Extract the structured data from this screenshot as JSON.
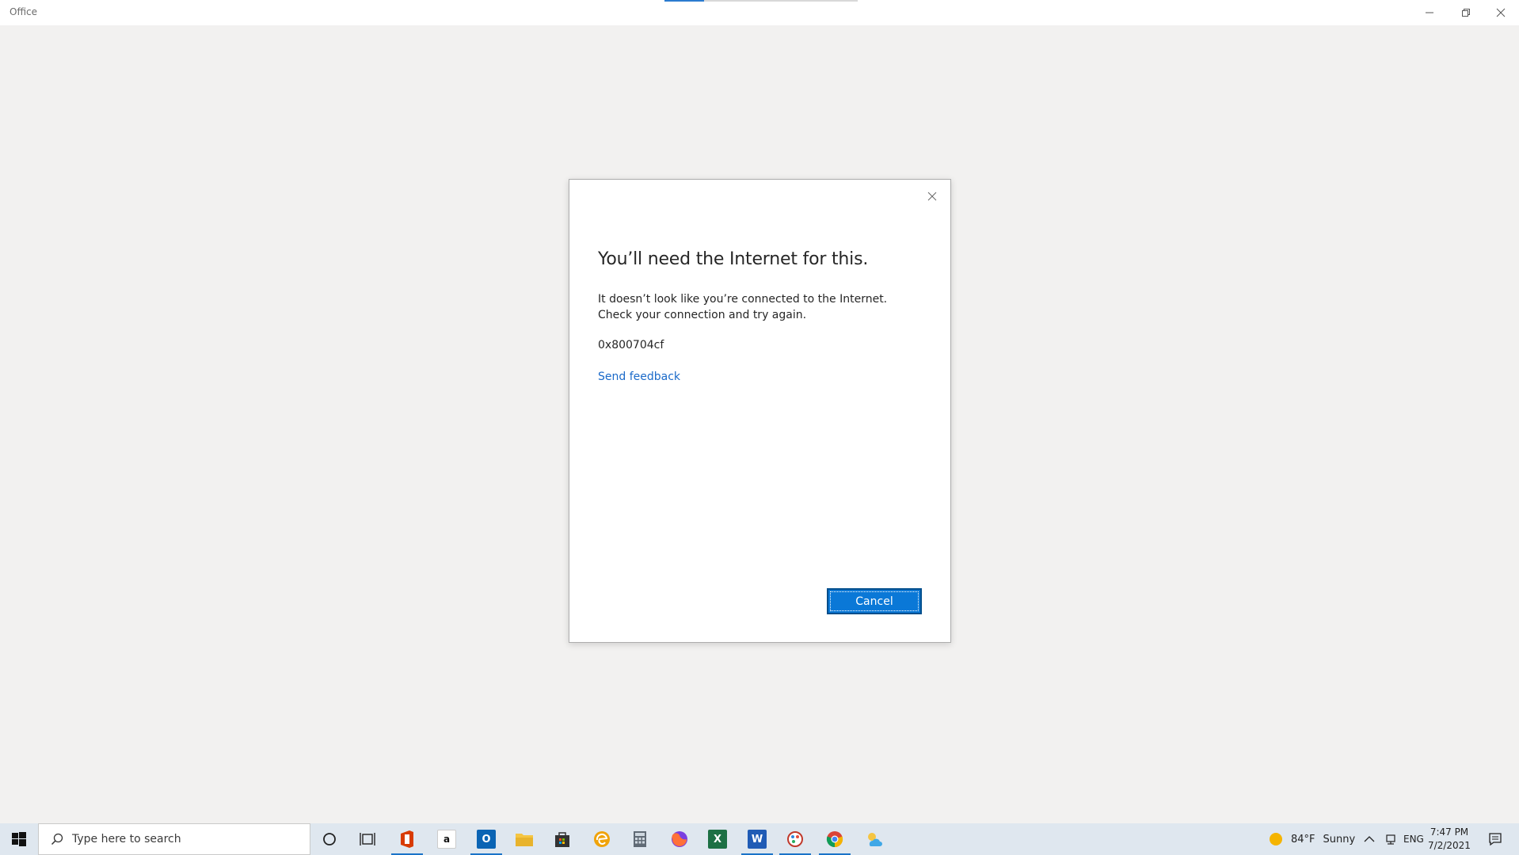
{
  "window": {
    "title": "Office",
    "minimize_icon": "minimize-icon",
    "restore_icon": "restore-icon",
    "close_icon": "close-icon"
  },
  "dialog": {
    "heading": "You’ll need the Internet for this.",
    "message": "It doesn’t look like you’re connected to the Internet. Check your connection and try again.",
    "error_code": "0x800704cf",
    "feedback_link": "Send feedback",
    "cancel_label": "Cancel"
  },
  "taskbar": {
    "search_placeholder": "Type here to search",
    "apps": [
      {
        "name": "cortana-icon"
      },
      {
        "name": "task-view-icon"
      },
      {
        "name": "office-icon"
      },
      {
        "name": "amazon-icon"
      },
      {
        "name": "outlook-icon"
      },
      {
        "name": "file-explorer-icon"
      },
      {
        "name": "store-icon"
      },
      {
        "name": "edge-icon"
      },
      {
        "name": "calculator-icon"
      },
      {
        "name": "firefox-icon"
      },
      {
        "name": "excel-icon"
      },
      {
        "name": "word-icon"
      },
      {
        "name": "paint-icon"
      },
      {
        "name": "chrome-icon"
      },
      {
        "name": "weather-app-icon"
      }
    ],
    "weather": {
      "temp": "84°F",
      "condition": "Sunny"
    },
    "language": "ENG",
    "time": "7:47 PM",
    "date": "7/2/2021"
  },
  "colors": {
    "accent": "#0a78d7",
    "link": "#1b6ac9",
    "taskbar": "#dfe7ef",
    "background": "#f2f1f0"
  }
}
